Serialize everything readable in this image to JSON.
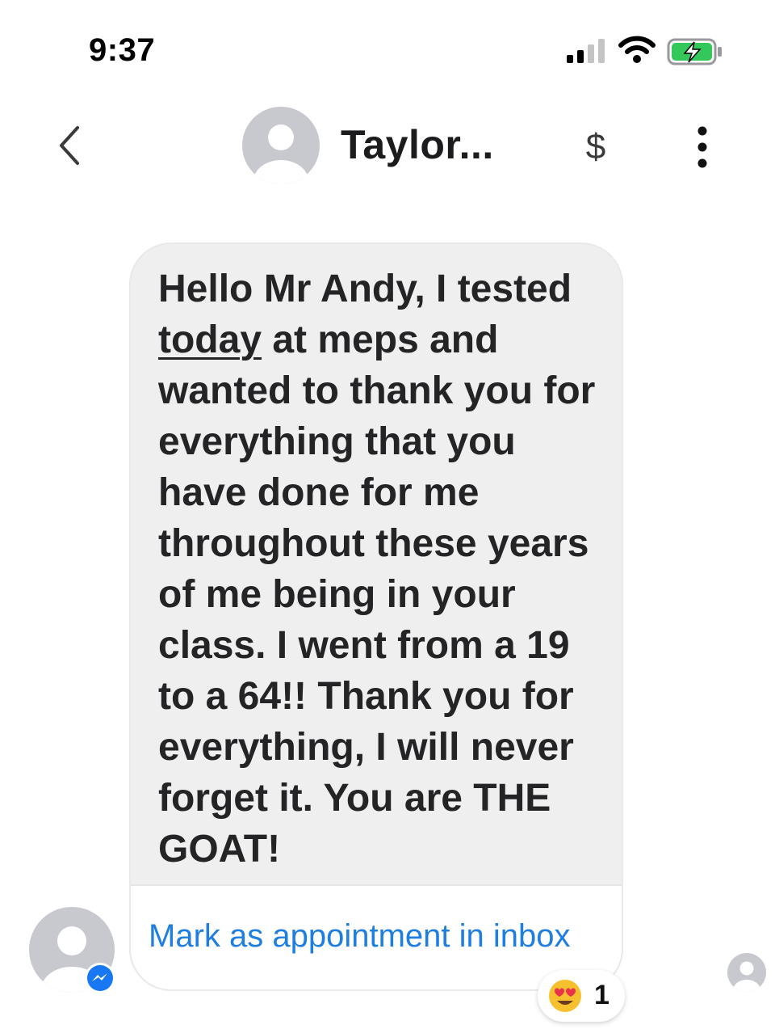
{
  "status_bar": {
    "time": "9:37",
    "icons": [
      "cellular-signal-icon",
      "wifi-icon",
      "battery-charging-icon"
    ]
  },
  "header": {
    "contact_name": "Taylor...",
    "dollar_symbol": "$",
    "icons": [
      "back-chevron-icon",
      "avatar-placeholder-icon",
      "dollar-icon",
      "more-vertical-icon"
    ]
  },
  "message": {
    "text_before_underline": "Hello Mr Andy, I tested ",
    "underlined": "today",
    "text_after_underline": " at meps and wanted to thank you for everything that you have done for me throughout these years of me being in your class. I went from a 19 to a 64!! Thank you for everything, I will never forget it. You are THE GOAT!",
    "action_link": "Mark as appointment in inbox"
  },
  "reaction": {
    "emoji_icon": "heart-eyes-emoji-icon",
    "count": "1"
  },
  "colors": {
    "bubble_bg": "#efeff0",
    "link_blue": "#1f7fe0",
    "messenger_blue": "#1877f2",
    "avatar_gray": "#c8c9cf",
    "battery_green": "#34c759"
  }
}
